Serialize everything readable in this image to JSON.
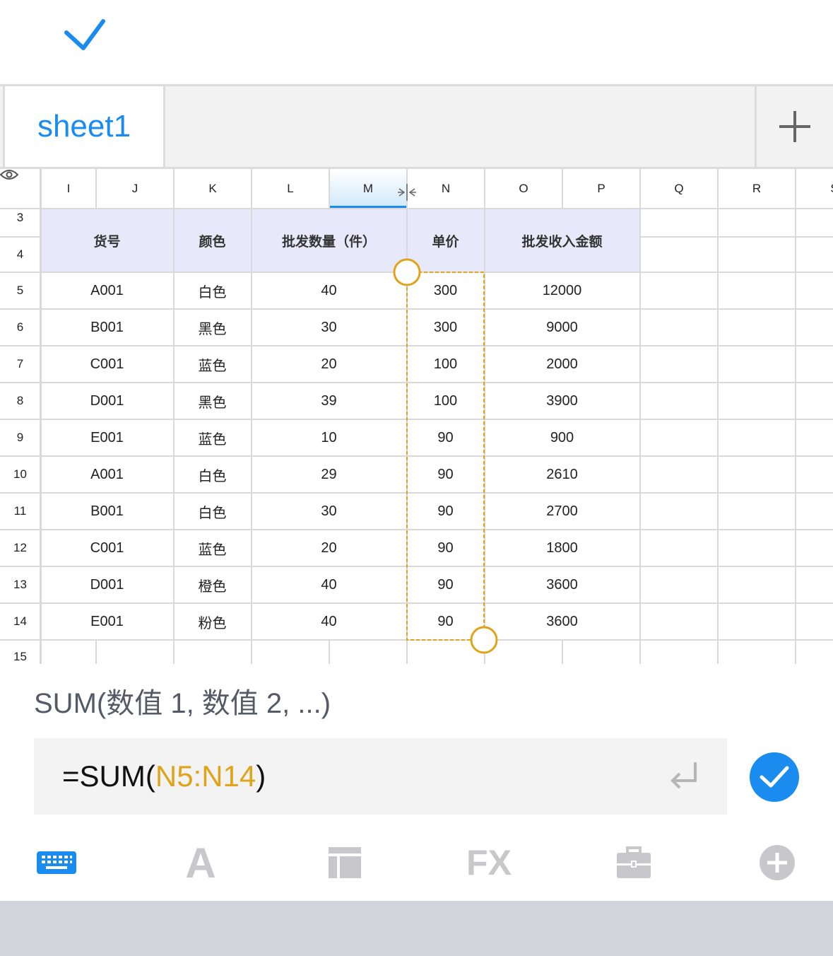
{
  "colors": {
    "accent": "#1a8cf0",
    "range": "#e0a41b",
    "header_fill": "#e8e8fb",
    "grid": "#dadada"
  },
  "sheet_tabs": [
    {
      "label": "sheet1",
      "active": true
    }
  ],
  "grid": {
    "column_headers": [
      "I",
      "J",
      "K",
      "L",
      "M",
      "N",
      "O",
      "P",
      "Q",
      "R",
      "S"
    ],
    "selected_column": "M",
    "row_numbers": [
      "3",
      "4",
      "5",
      "6",
      "7",
      "8",
      "9",
      "10",
      "11",
      "12",
      "13",
      "14",
      "15"
    ],
    "table_headers": {
      "item_no": "货号",
      "color": "颜色",
      "quantity": "批发数量（件）",
      "unit_price": "单价",
      "revenue": "批发收入金额"
    },
    "rows": [
      {
        "item_no": "A001",
        "color": "白色",
        "quantity": "40",
        "unit_price": "300",
        "revenue": "12000"
      },
      {
        "item_no": "B001",
        "color": "黑色",
        "quantity": "30",
        "unit_price": "300",
        "revenue": "9000"
      },
      {
        "item_no": "C001",
        "color": "蓝色",
        "quantity": "20",
        "unit_price": "100",
        "revenue": "2000"
      },
      {
        "item_no": "D001",
        "color": "黑色",
        "quantity": "39",
        "unit_price": "100",
        "revenue": "3900"
      },
      {
        "item_no": "E001",
        "color": "蓝色",
        "quantity": "10",
        "unit_price": "90",
        "revenue": "900"
      },
      {
        "item_no": "A001",
        "color": "白色",
        "quantity": "29",
        "unit_price": "90",
        "revenue": "2610"
      },
      {
        "item_no": "B001",
        "color": "白色",
        "quantity": "30",
        "unit_price": "90",
        "revenue": "2700"
      },
      {
        "item_no": "C001",
        "color": "蓝色",
        "quantity": "20",
        "unit_price": "90",
        "revenue": "1800"
      },
      {
        "item_no": "D001",
        "color": "橙色",
        "quantity": "40",
        "unit_price": "90",
        "revenue": "3600"
      },
      {
        "item_no": "E001",
        "color": "粉色",
        "quantity": "40",
        "unit_price": "90",
        "revenue": "3600"
      }
    ]
  },
  "formula": {
    "hint": "SUM(数值 1, 数值 2, ...)",
    "prefix": "=SUM(",
    "range": "N5:N14",
    "suffix": ")"
  },
  "toolbar": {
    "icons": [
      "keyboard-icon",
      "font-icon",
      "layout-icon",
      "fx-icon",
      "toolbox-icon",
      "plus-circle-icon"
    ],
    "font_label": "A",
    "fx_label": "FX"
  }
}
